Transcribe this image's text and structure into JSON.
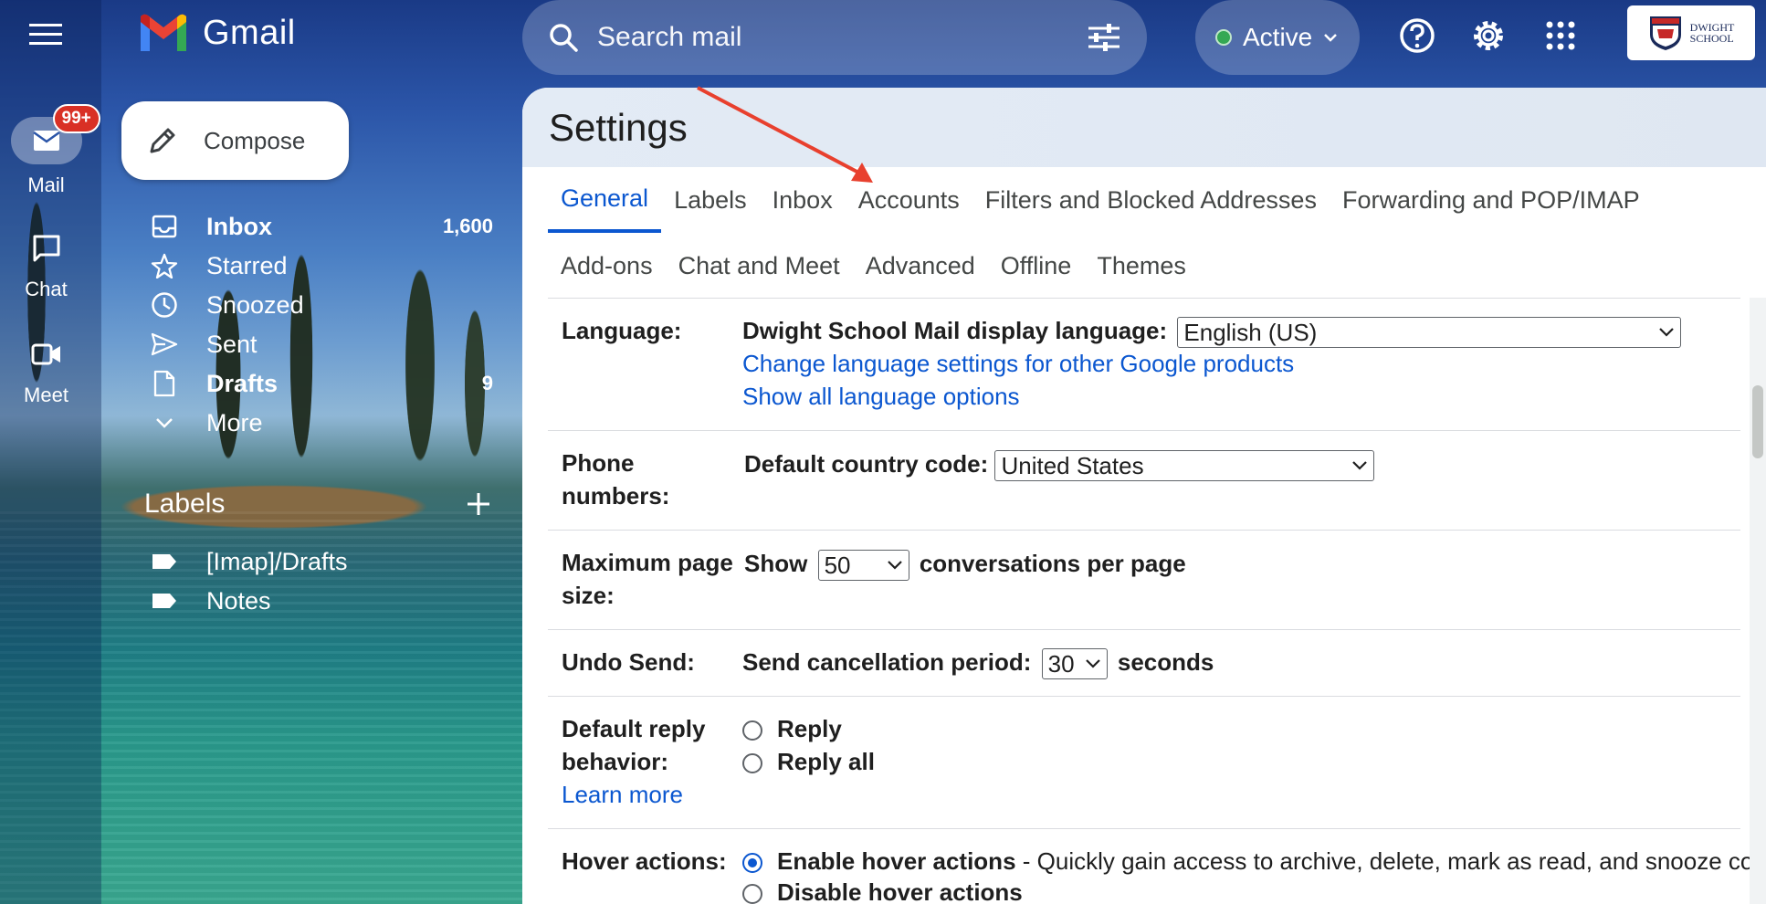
{
  "app": {
    "name": "Gmail"
  },
  "search": {
    "placeholder": "Search mail"
  },
  "status": {
    "label": "Active",
    "color": "#34a853"
  },
  "org": {
    "line1": "DWIGHT",
    "line2": "SCHOOL"
  },
  "rail": [
    {
      "label": "Mail",
      "badge": "99+"
    },
    {
      "label": "Chat"
    },
    {
      "label": "Meet"
    }
  ],
  "compose": {
    "label": "Compose"
  },
  "nav": [
    {
      "label": "Inbox",
      "count": "1,600"
    },
    {
      "label": "Starred"
    },
    {
      "label": "Snoozed"
    },
    {
      "label": "Sent"
    },
    {
      "label": "Drafts",
      "count": "9"
    },
    {
      "label": "More"
    }
  ],
  "labels": {
    "title": "Labels",
    "items": [
      "[Imap]/Drafts",
      "Notes"
    ]
  },
  "settings": {
    "title": "Settings",
    "tabs_row1": [
      "General",
      "Labels",
      "Inbox",
      "Accounts",
      "Filters and Blocked Addresses",
      "Forwarding and POP/IMAP"
    ],
    "tabs_row2": [
      "Add-ons",
      "Chat and Meet",
      "Advanced",
      "Offline",
      "Themes"
    ],
    "active_tab": "General",
    "language": {
      "label": "Language:",
      "display_label": "Dwight School Mail display language:",
      "value": "English (US)",
      "link1": "Change language settings for other Google products",
      "link2": "Show all language options"
    },
    "phone": {
      "label_line1": "Phone",
      "label_line2": "numbers:",
      "country_label": "Default country code:",
      "value": "United States"
    },
    "page_size": {
      "label_line1": "Maximum page",
      "label_line2": "size:",
      "prefix": "Show",
      "value": "50",
      "suffix": "conversations per page"
    },
    "undo_send": {
      "label": "Undo Send:",
      "period_label": "Send cancellation period:",
      "value": "30",
      "suffix": "seconds"
    },
    "reply": {
      "label_line1": "Default reply",
      "label_line2": "behavior:",
      "learn_more": "Learn more",
      "option1": "Reply",
      "option2": "Reply all"
    },
    "hover": {
      "label": "Hover actions:",
      "enable": "Enable hover actions",
      "enable_desc": " - Quickly gain access to archive, delete, mark as read, and snooze con",
      "disable": "Disable hover actions"
    }
  },
  "colors": {
    "accent": "#0b57d0",
    "badge": "#d93025",
    "arrow": "#e8402e"
  }
}
